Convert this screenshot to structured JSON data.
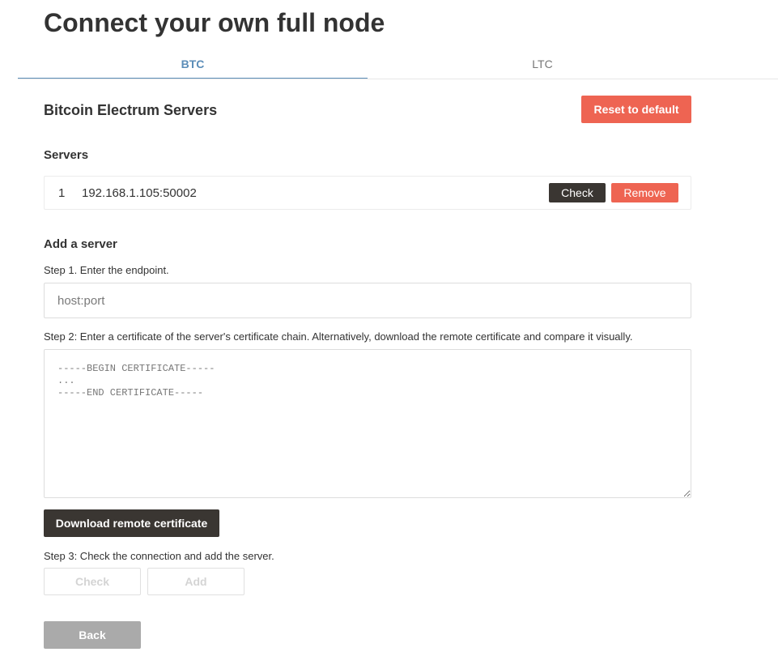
{
  "page": {
    "title": "Connect your own full node"
  },
  "tabs": [
    {
      "label": "BTC",
      "active": true
    },
    {
      "label": "LTC",
      "active": false
    }
  ],
  "servers_section": {
    "title": "Bitcoin Electrum Servers",
    "reset_label": "Reset to default",
    "list_label": "Servers",
    "servers": [
      {
        "index": "1",
        "address": "192.168.1.105:50002",
        "check_label": "Check",
        "remove_label": "Remove"
      }
    ]
  },
  "add_server": {
    "title": "Add a server",
    "step1": "Step 1. Enter the endpoint.",
    "endpoint_placeholder": "host:port",
    "step2": "Step 2: Enter a certificate of the server's certificate chain. Alternatively, download the remote certificate and compare it visually.",
    "certificate_placeholder": "-----BEGIN CERTIFICATE-----\n...\n-----END CERTIFICATE-----",
    "download_label": "Download remote certificate",
    "step3": "Step 3: Check the connection and add the server.",
    "check_label": "Check",
    "add_label": "Add"
  },
  "footer": {
    "back_label": "Back"
  },
  "colors": {
    "accent_tab": "#5b8db8",
    "danger": "#ee6452",
    "dark_button": "#3a3632",
    "disabled_button": "#aaaaaa"
  }
}
